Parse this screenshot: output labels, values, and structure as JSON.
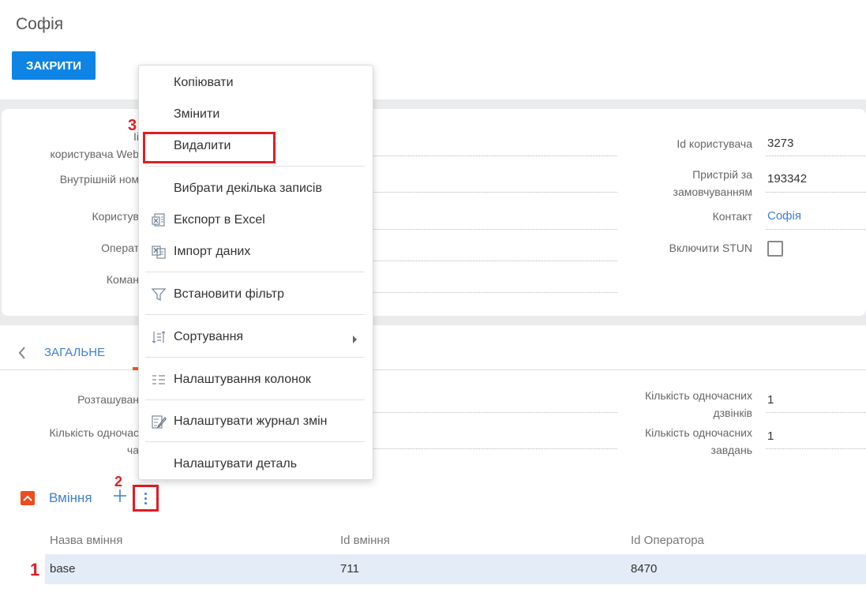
{
  "page": {
    "title": "Софія",
    "close_label": "ЗАКРИТИ"
  },
  "form": {
    "left_labels": {
      "user_web_a": "Іі",
      "user_web_b": "користувача Web",
      "internal_number": "Внутрішній ном",
      "user": "Користув",
      "operator": "Операт",
      "team": "Коман"
    },
    "right": {
      "user_id_label": "Id користувача",
      "user_id_value": "3273",
      "default_device_label_1": "Пристрій за",
      "default_device_label_2": "замовчуванням",
      "default_device_value": "193342",
      "contact_label": "Контакт",
      "contact_value": "Софія",
      "stun_label": "Включити STUN"
    }
  },
  "tabs": {
    "general": "ЗАГАЛЬНЕ"
  },
  "general": {
    "location_label": "Розташуван",
    "simultaneous_label_1": "Кількість одночас",
    "simultaneous_label_2": "ча",
    "calls_label_1": "Кількість одночасних",
    "calls_label_2": "дзвінків",
    "calls_value": "1",
    "tasks_label_1": "Кількість одночасних",
    "tasks_label_2": "завдань",
    "tasks_value": "1"
  },
  "detail": {
    "title": "Вміння",
    "columns": [
      "Назва вміння",
      "Id вміння",
      "Id Оператора"
    ],
    "rows": [
      {
        "name": "base",
        "id": "711",
        "operator_id": "8470"
      }
    ]
  },
  "context_menu": {
    "items": [
      {
        "label": "Копіювати",
        "icon": ""
      },
      {
        "label": "Змінити",
        "icon": ""
      },
      {
        "label": "Видалити",
        "icon": ""
      },
      {
        "label": "Вибрати декілька записів",
        "icon": ""
      },
      {
        "label": "Експорт в Excel",
        "icon": "excel-export-icon"
      },
      {
        "label": "Імпорт даних",
        "icon": "data-import-icon"
      },
      {
        "label": "Встановити фільтр",
        "icon": "filter-icon"
      },
      {
        "label": "Сортування",
        "icon": "sort-icon"
      },
      {
        "label": "Налаштування колонок",
        "icon": "columns-settings-icon"
      },
      {
        "label": "Налаштувати журнал змін",
        "icon": "change-log-icon"
      },
      {
        "label": "Налаштувати деталь",
        "icon": ""
      }
    ]
  },
  "annotations": {
    "step1": "1",
    "step2": "2",
    "step3": "3"
  },
  "colors": {
    "primary": "#0e84e5",
    "link": "#3f7fd0",
    "highlight": "#e31b23",
    "accent": "#f05a22",
    "row_selected": "#e4ecf7"
  }
}
